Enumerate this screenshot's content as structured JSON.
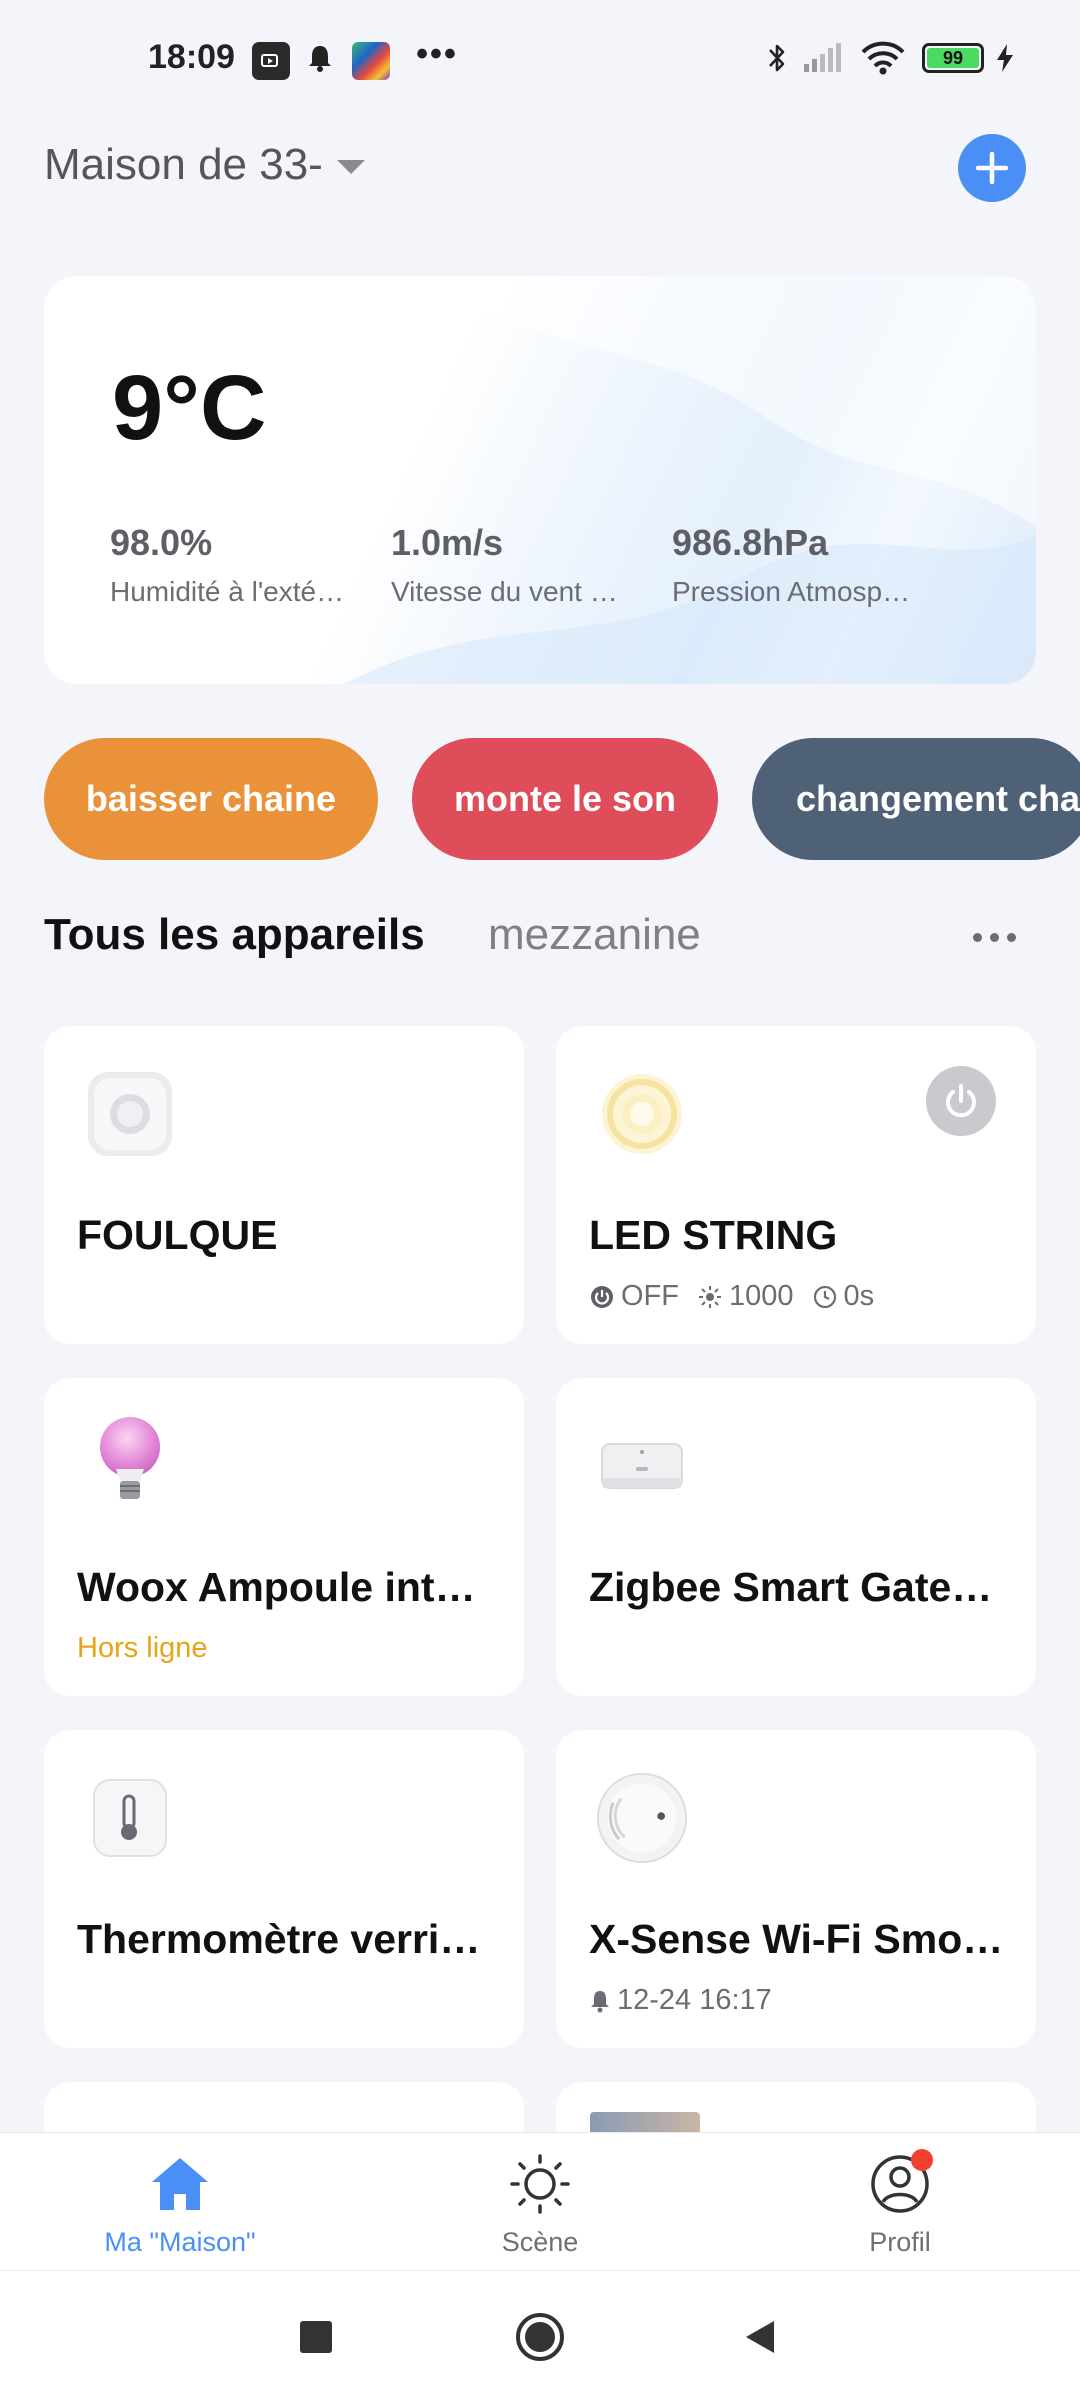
{
  "status_bar": {
    "time": "18:09",
    "more": "•••",
    "battery": "99"
  },
  "header": {
    "home_name": "Maison de 33-"
  },
  "weather": {
    "temperature": "9°C",
    "stats": [
      {
        "value": "98.0%",
        "label": "Humidité à l'exté…"
      },
      {
        "value": "1.0m/s",
        "label": "Vitesse du vent à…"
      },
      {
        "value": "986.8hPa",
        "label": "Pression Atmosp…"
      }
    ]
  },
  "scenes": [
    {
      "label": "baisser chaine",
      "color": "#ea9239"
    },
    {
      "label": "monte le son",
      "color": "#df4c5a"
    },
    {
      "label": "changement cha",
      "color": "#4f6177"
    }
  ],
  "tabs": {
    "active": "Tous les appareils",
    "inactive": "mezzanine"
  },
  "devices": [
    {
      "name": "FOULQUE",
      "icon": "motion-sensor-icon"
    },
    {
      "name": "LED STRING",
      "icon": "led-string-icon",
      "status": {
        "power": "OFF",
        "brightness": "1000",
        "timer": "0s"
      }
    },
    {
      "name": "Woox Ampoule int…",
      "icon": "bulb-icon",
      "sub": "Hors ligne"
    },
    {
      "name": "Zigbee Smart Gate…",
      "icon": "gateway-icon"
    },
    {
      "name": "Thermomètre verri…",
      "icon": "thermometer-icon"
    },
    {
      "name": "X-Sense Wi-Fi Smo…",
      "icon": "smoke-detector-icon",
      "sub": "12-24 16:17"
    }
  ],
  "bottom_nav": [
    {
      "label": "Ma \"Maison\"",
      "icon": "home-icon",
      "active": true
    },
    {
      "label": "Scène",
      "icon": "sun-icon"
    },
    {
      "label": "Profil",
      "icon": "profile-icon"
    }
  ],
  "colors": {
    "accent": "#4a8ff5",
    "offline": "#e6a417",
    "notification_dot": "#f0402f"
  }
}
